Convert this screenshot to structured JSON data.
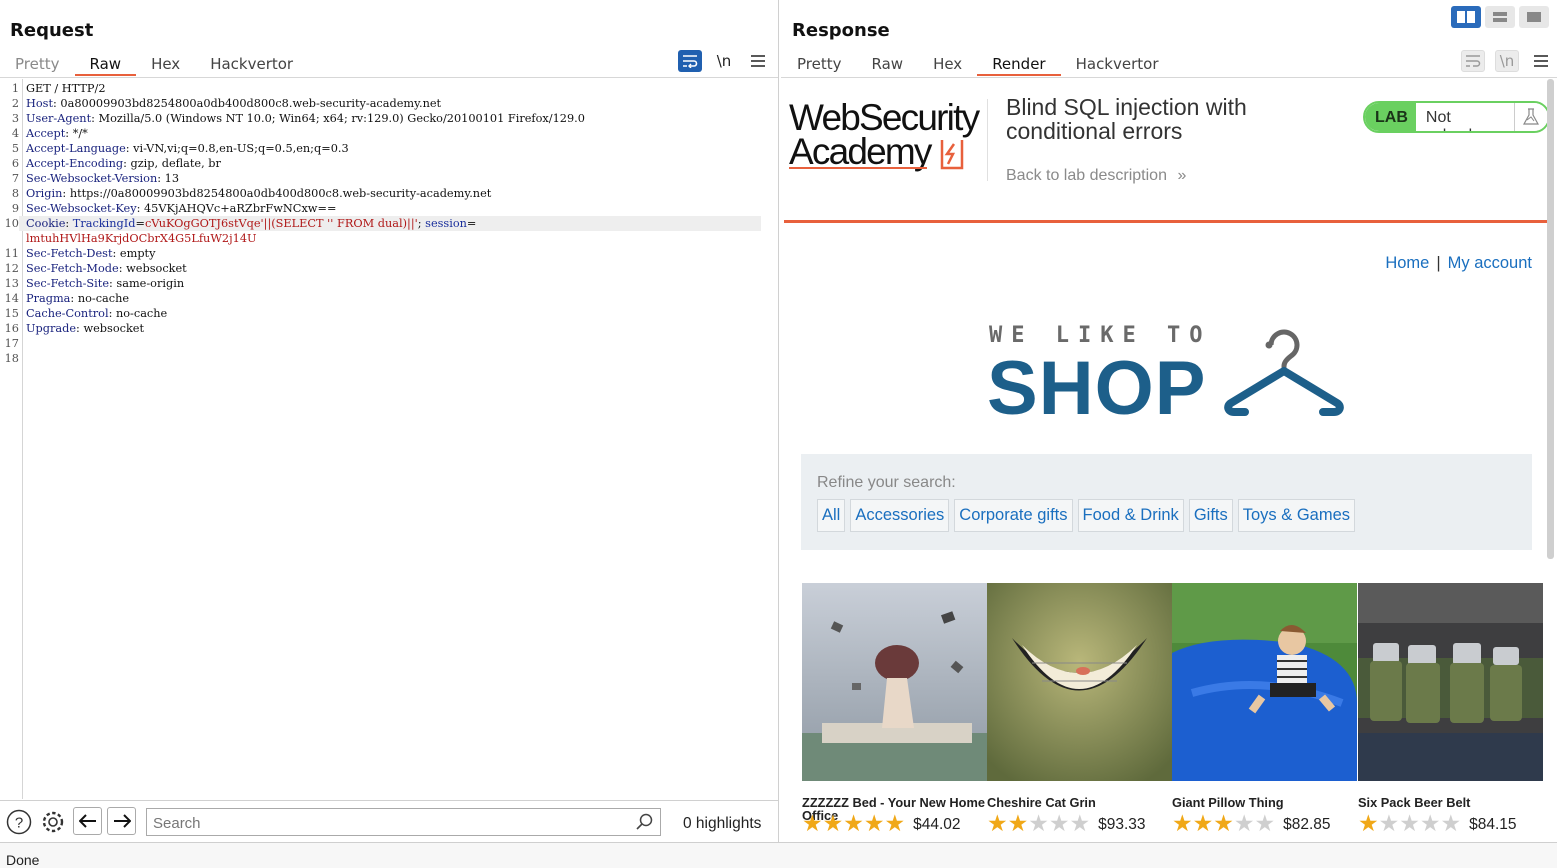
{
  "request": {
    "title": "Request",
    "tabs": [
      "Pretty",
      "Raw",
      "Hex",
      "Hackvertor"
    ],
    "active_tab": "Raw",
    "icons": {
      "wrap": "wrap-lines-icon",
      "newline": "\\n",
      "menu": "menu-icon"
    },
    "lines": [
      {
        "n": "1",
        "key": "",
        "val": "GET / HTTP/2"
      },
      {
        "n": "2",
        "key": "Host",
        "val": "0a80009903bd8254800a0db400d800c8.web-security-academy.net"
      },
      {
        "n": "3",
        "key": "User-Agent",
        "val": "Mozilla/5.0 (Windows NT 10.0; Win64; x64; rv:129.0) Gecko/20100101 Firefox/129.0"
      },
      {
        "n": "4",
        "key": "Accept",
        "val": "*/*"
      },
      {
        "n": "5",
        "key": "Accept-Language",
        "val": "vi-VN,vi;q=0.8,en-US;q=0.5,en;q=0.3"
      },
      {
        "n": "6",
        "key": "Accept-Encoding",
        "val": "gzip, deflate, br"
      },
      {
        "n": "7",
        "key": "Sec-Websocket-Version",
        "val": "13"
      },
      {
        "n": "8",
        "key": "Origin",
        "val": "https://0a80009903bd8254800a0db400d800c8.web-security-academy.net"
      },
      {
        "n": "9",
        "key": "Sec-Websocket-Key",
        "val": "45VKjAHQVc+aRZbrFwNCxw=="
      },
      {
        "n": "11",
        "key": "Sec-Fetch-Dest",
        "val": "empty"
      },
      {
        "n": "12",
        "key": "Sec-Fetch-Mode",
        "val": "websocket"
      },
      {
        "n": "13",
        "key": "Sec-Fetch-Site",
        "val": "same-origin"
      },
      {
        "n": "14",
        "key": "Pragma",
        "val": "no-cache"
      },
      {
        "n": "15",
        "key": "Cache-Control",
        "val": "no-cache"
      },
      {
        "n": "16",
        "key": "Upgrade",
        "val": "websocket"
      },
      {
        "n": "17",
        "key": "",
        "val": ""
      },
      {
        "n": "18",
        "key": "",
        "val": ""
      }
    ],
    "cookie_line": {
      "n": "10",
      "key": "Cookie",
      "name1": "TrackingId",
      "value1": "cVuKOgGOTJ6stVqe'||(SELECT '' FROM dual)||'",
      "name2": "session",
      "value2": "lmtuhHVlHa9KrjdOCbrX4G5LfuW2j14U"
    },
    "search": {
      "placeholder": "Search",
      "highlights": "0 highlights"
    }
  },
  "status": "Done",
  "response": {
    "title": "Response",
    "tabs": [
      "Pretty",
      "Raw",
      "Hex",
      "Render",
      "Hackvertor"
    ],
    "active_tab": "Render",
    "render": {
      "logo_line1": "WebSecurity",
      "logo_line2": "Academy",
      "lab_title": "Blind SQL injection with conditional errors",
      "back_link": "Back to lab description",
      "back_glyph": "»",
      "lab_badge": "LAB",
      "lab_status": "Not solved",
      "nav": {
        "home": "Home",
        "separator": "|",
        "account": "My account"
      },
      "shop_tagline": "WE LIKE TO",
      "shop_word": "SHOP",
      "refine_label": "Refine your search:",
      "filters": [
        "All",
        "Accessories",
        "Corporate gifts",
        "Food & Drink",
        "Gifts",
        "Toys & Games"
      ],
      "products": [
        {
          "name": "ZZZZZZ Bed - Your New Home Office",
          "rating": 5,
          "price": "$44.02"
        },
        {
          "name": "Cheshire Cat Grin",
          "rating": 2,
          "price": "$93.33"
        },
        {
          "name": "Giant Pillow Thing",
          "rating": 3,
          "price": "$82.85"
        },
        {
          "name": "Six Pack Beer Belt",
          "rating": 1,
          "price": "$84.15"
        }
      ]
    }
  },
  "colors": {
    "accent": "#e8603c",
    "link": "#1a6fbf",
    "brand_blue": "#1d5f8a",
    "badge_green": "#6ad060"
  }
}
